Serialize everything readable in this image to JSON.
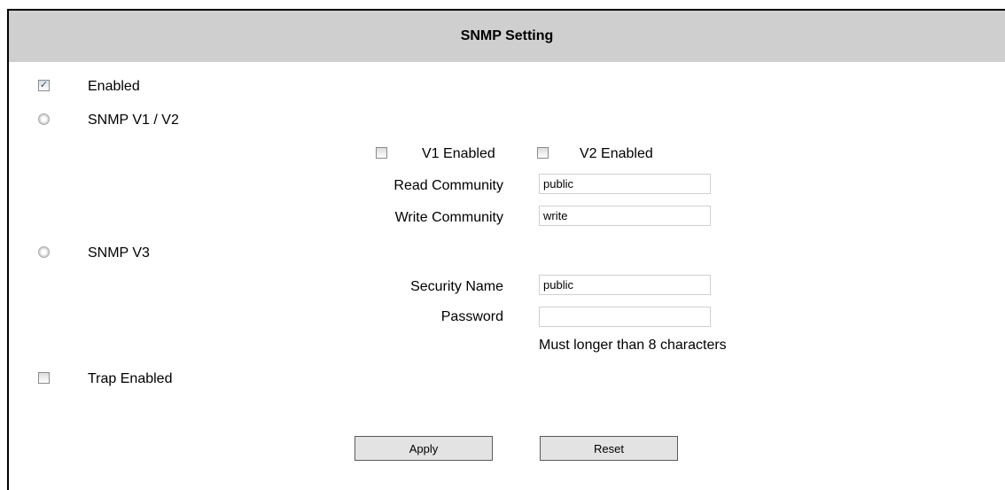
{
  "header": {
    "title": "SNMP Setting"
  },
  "enabled": {
    "label": "Enabled",
    "checked": true
  },
  "snmp_v12": {
    "label": "SNMP V1 / V2",
    "v1_label": "V1 Enabled",
    "v2_label": "V2 Enabled",
    "read_community_label": "Read Community",
    "read_community_value": "public",
    "write_community_label": "Write Community",
    "write_community_value": "write"
  },
  "snmp_v3": {
    "label": "SNMP V3",
    "security_name_label": "Security Name",
    "security_name_value": "public",
    "password_label": "Password",
    "password_value": "",
    "password_hint": "Must longer than 8 characters"
  },
  "trap": {
    "label": "Trap Enabled"
  },
  "buttons": {
    "apply": "Apply",
    "reset": "Reset"
  },
  "colors": {
    "header_bg": "#cfcfcf",
    "checkmark": "#21509e"
  }
}
